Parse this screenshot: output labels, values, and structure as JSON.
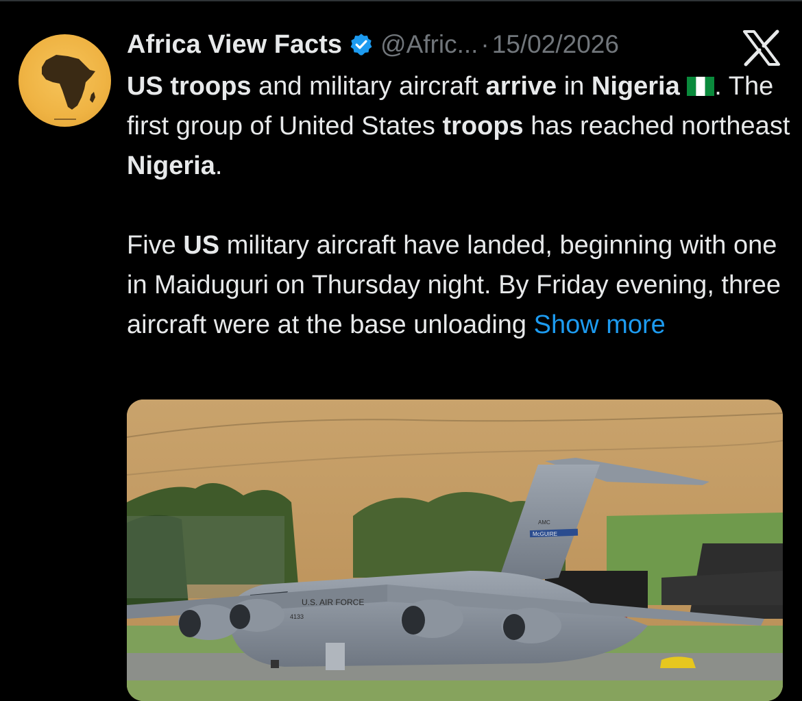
{
  "header": {
    "name": "Africa View Facts",
    "handle": "@Afric...",
    "separator": "·",
    "date": "15/02/2026"
  },
  "icons": {
    "avatar": "africa-map-avatar-icon",
    "verified": "verified-badge-icon",
    "platform": "x-logo-icon",
    "flag": "nigeria-flag-icon"
  },
  "colors": {
    "background": "#000000",
    "text": "#e7e9ea",
    "muted": "#71767b",
    "link": "#1d9bf0",
    "verified": "#1d9bf0"
  },
  "tweet": {
    "p1": {
      "s1": "US troops",
      "s2": " and military aircraft ",
      "s3": "arrive",
      "s4": " in ",
      "s5": "Nigeria",
      "s6": ". The first group of United States ",
      "s7": "troops",
      "s8": " has reached northeast ",
      "s9": "Nigeria",
      "s10": "."
    },
    "p2": {
      "s1": "Five ",
      "s2": "US",
      "s3": " military aircraft have landed, beginning with one in Maiduguri on Thursday night. By Friday evening, three aircraft were at the base unloading"
    },
    "show_more": "Show more"
  },
  "media": {
    "aircraft_markings": {
      "fuselage": "U.S. AIR FORCE",
      "tail_band": "McGUIRE",
      "tail_code": "AMC",
      "tail_number": "4133"
    }
  }
}
